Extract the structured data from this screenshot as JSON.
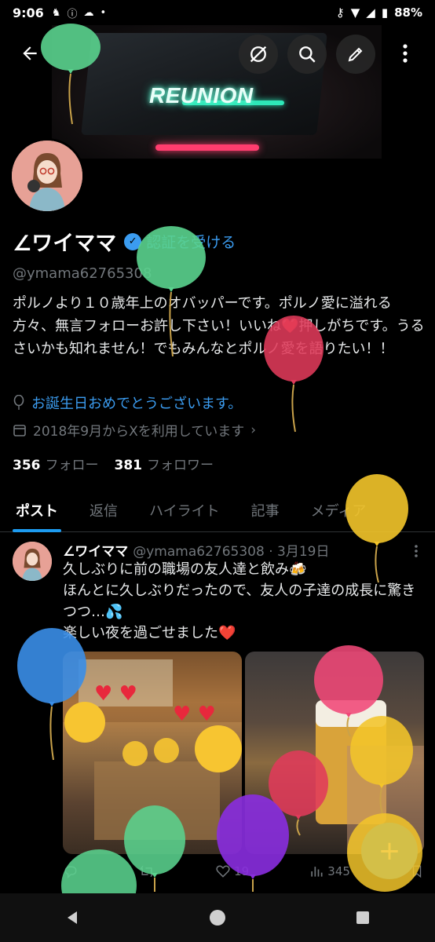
{
  "status_bar": {
    "time": "9:06",
    "battery": "88%"
  },
  "banner": {
    "neon_text": "REUNION"
  },
  "profile": {
    "name": "∠ワイママ",
    "verify_label": "認証を受ける",
    "handle": "@ymama62765308",
    "bio_line1": "ポルノより１０歳年上のオバッパーです。ポルノ愛に溢れる方々、無言フォローお許し下さい！いいね",
    "bio_heart": "❤️",
    "bio_line2": "押しがちです。うるさいかも知れません！でもみんなとポルノ愛を語りたい！！",
    "birthday": "お誕生日おめでとうございます。",
    "joined": "2018年9月からXを利用しています",
    "following_count": "356",
    "following_label": "フォロー",
    "followers_count": "381",
    "followers_label": "フォロワー"
  },
  "tabs": [
    "ポスト",
    "返信",
    "ハイライト",
    "記事",
    "メディア"
  ],
  "post": {
    "name": "∠ワイママ",
    "handle_date": "@ymama62765308 · 3月19日",
    "line1": "久しぶりに前の職場の友人達と飲み🍻",
    "line2": "ほんとに久しぶりだったので、友人の子達の成長に驚きつつ…💦",
    "line3": "楽しい夜を過ごせました",
    "heart": "❤️",
    "likes": "19",
    "views": "345"
  },
  "fab_label": "+",
  "colors": {
    "accent": "#1d9bf0",
    "verify": "#3b9cf0",
    "heart": "#e8283c"
  }
}
